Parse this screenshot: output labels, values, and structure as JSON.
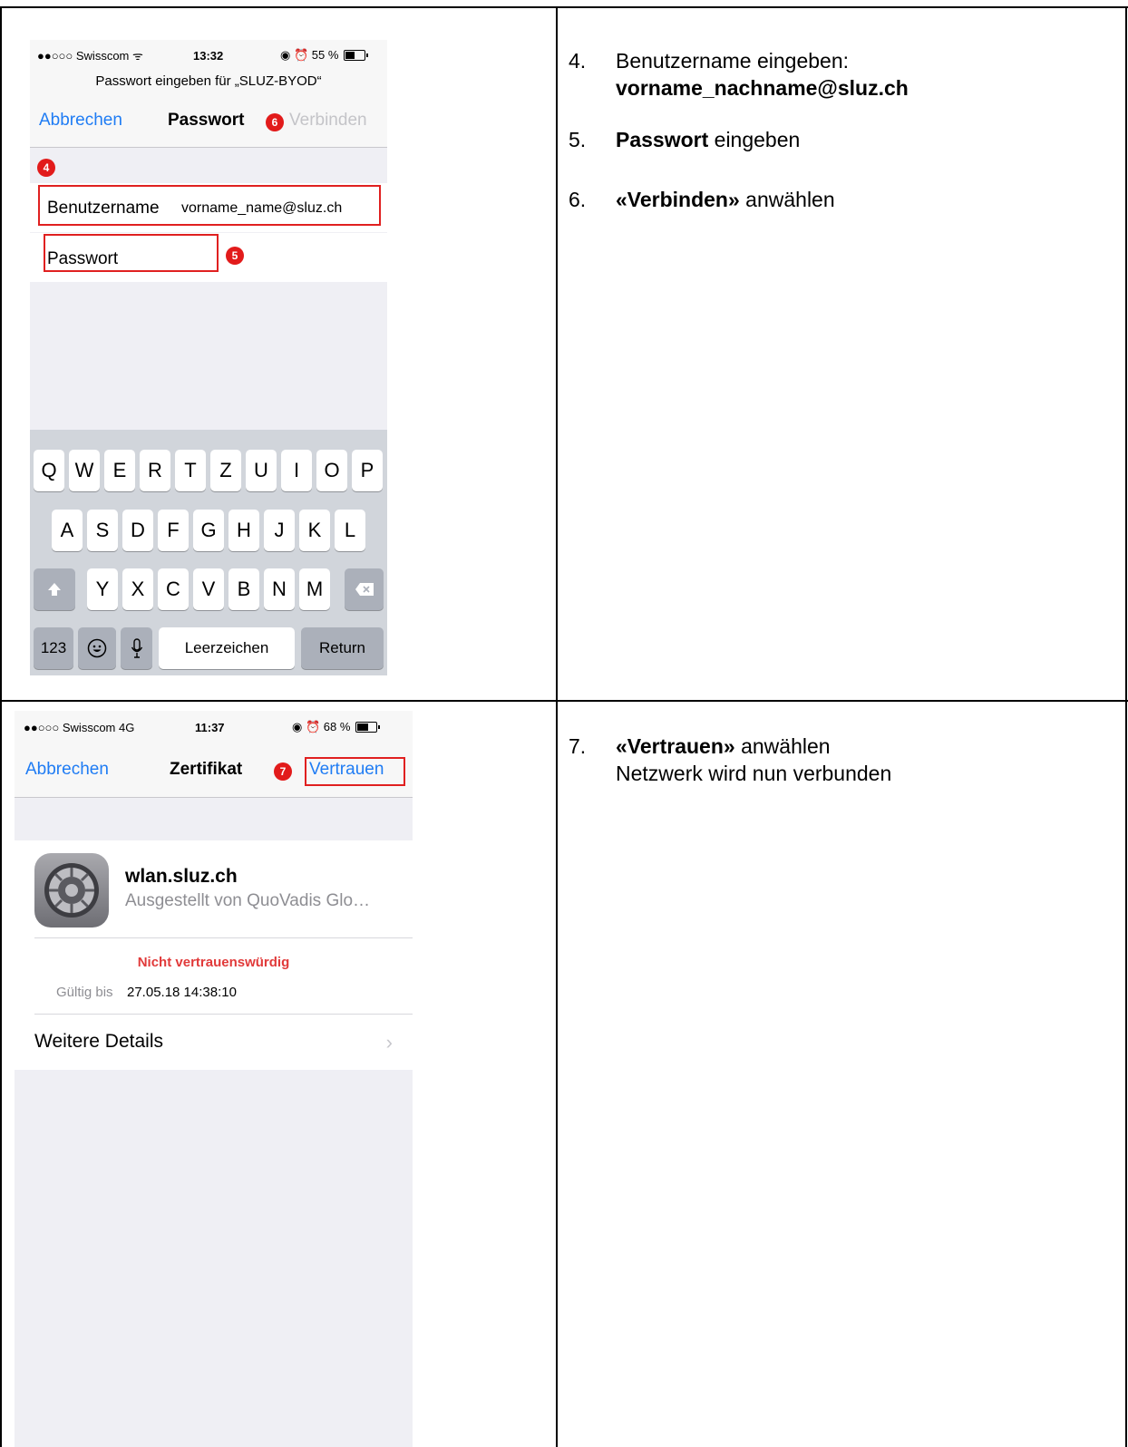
{
  "colors": {
    "ios_blue": "#1f7cf4",
    "marker_red": "#e21b1b",
    "warning_red": "#e13a3a",
    "disabled_gray": "#c4c4c8"
  },
  "screen1": {
    "status": {
      "carrier": "●●○○○ Swisscom ᯤ",
      "time": "13:32",
      "indicators": "◉ ⏰ 55 %",
      "battery_level": 0.55
    },
    "prompt": "Passwort eingeben für „SLUZ-BYOD“",
    "nav": {
      "cancel": "Abbrechen",
      "title": "Passwort",
      "connect": "Verbinden"
    },
    "markers": {
      "m4": "4",
      "m5": "5",
      "m6": "6"
    },
    "fields": {
      "username_label": "Benutzername",
      "username_value": "vorname_name@sluz.ch",
      "password_label": "Passwort"
    },
    "keyboard": {
      "row1": [
        "Q",
        "W",
        "E",
        "R",
        "T",
        "Z",
        "U",
        "I",
        "O",
        "P"
      ],
      "row2": [
        "A",
        "S",
        "D",
        "F",
        "G",
        "H",
        "J",
        "K",
        "L"
      ],
      "row3": [
        "Y",
        "X",
        "C",
        "V",
        "B",
        "N",
        "M"
      ],
      "numbers": "123",
      "space": "Leerzeichen",
      "return": "Return"
    }
  },
  "instructions1": {
    "step4_num": "4.",
    "step4_text": "Benutzername eingeben:",
    "step4_bold": "vorname_nachname@sluz.ch",
    "step5_num": "5.",
    "step5_bold": "Passwort",
    "step5_text": " eingeben",
    "step6_num": "6.",
    "step6_bold": "«Verbinden»",
    "step6_text": " anwählen"
  },
  "screen2": {
    "status": {
      "carrier": "●●○○○ Swisscom  4G",
      "time": "11:37",
      "indicators": "◉ ⏰ 68 %",
      "battery_level": 0.68
    },
    "nav": {
      "cancel": "Abbrechen",
      "title": "Zertifikat",
      "trust": "Vertrauen"
    },
    "markers": {
      "m7": "7"
    },
    "certificate": {
      "name": "wlan.sluz.ch",
      "issuer": "Ausgestellt von QuoVadis Glo…",
      "status": "Nicht vertrauenswürdig",
      "valid_label": "Gültig bis",
      "valid_value": "27.05.18 14:38:10",
      "details": "Weitere Details"
    }
  },
  "instructions2": {
    "step7_num": "7.",
    "step7_bold": "«Vertrauen»",
    "step7_text": " anwählen",
    "step7_line2": "Netzwerk wird nun verbunden"
  }
}
